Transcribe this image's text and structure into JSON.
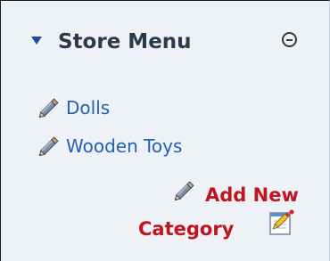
{
  "menu": {
    "title": "Store Menu",
    "collapse_icon": "minus-circle-icon",
    "colors": {
      "header_text": "#2d3a49",
      "link": "#2560b4",
      "add_link": "#c0141f",
      "panel_bg": "#eef2f7"
    }
  },
  "categories": [
    {
      "label": "Dolls",
      "icon": "pencil-icon"
    },
    {
      "label": "Wooden Toys",
      "icon": "pencil-icon"
    }
  ],
  "add_category": {
    "line1": "Add New",
    "line2": "Category",
    "edit_icon": "pencil-icon",
    "note_icon": "note-edit-icon"
  }
}
